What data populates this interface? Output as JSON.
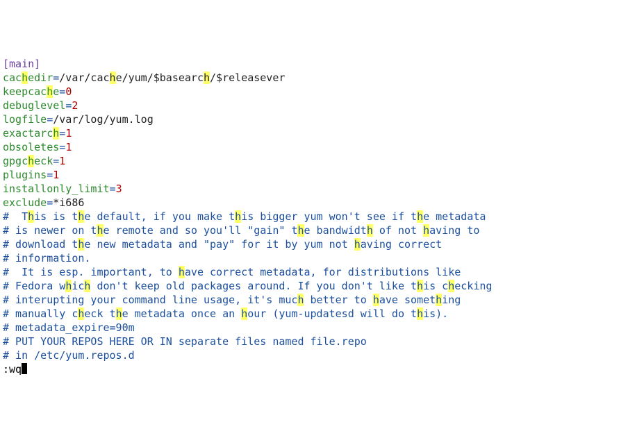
{
  "config": {
    "section": "[main]",
    "cachedir_key": "cachedir",
    "cachedir_val": "/var/cache/yum/$basearch/$releasever",
    "keepcache_key": "keepcache",
    "keepcache_val": "0",
    "debuglevel_key": "debuglevel",
    "debuglevel_val": "2",
    "logfile_key": "logfile",
    "logfile_val": "/var/log/yum.log",
    "exactarch_key": "exactarch",
    "exactarch_val": "1",
    "obsoletes_key": "obsoletes",
    "obsoletes_val": "1",
    "gpgcheck_key": "gpgcheck",
    "gpgcheck_val": "1",
    "plugins_key": "plugins",
    "plugins_val": "1",
    "installonly_limit_key": "installonly_limit",
    "installonly_limit_val": "3",
    "exclude_key": "exclude",
    "exclude_val": "*i686"
  },
  "comments": {
    "c1": "#  This is the default, if you make this bigger yum won't see if the metadata",
    "c2": "# is newer on the remote and so you'll \"gain\" the bandwidth of not having to",
    "c3": "# download the new metadata and \"pay\" for it by yum not having correct",
    "c4": "# information.",
    "c5": "#  It is esp. important, to have correct metadata, for distributions like",
    "c6": "# Fedora which don't keep old packages around. If you don't like this checking",
    "c7": "# interupting your command line usage, it's much better to have something",
    "c8": "# manually check the metadata once an hour (yum-updatesd will do this).",
    "c9": "# metadata_expire=90m",
    "c10": "",
    "c11": "# PUT YOUR REPOS HERE OR IN separate files named file.repo",
    "c12": "# in /etc/yum.repos.d"
  },
  "cmdline": ":wq",
  "highlight_char": "h"
}
